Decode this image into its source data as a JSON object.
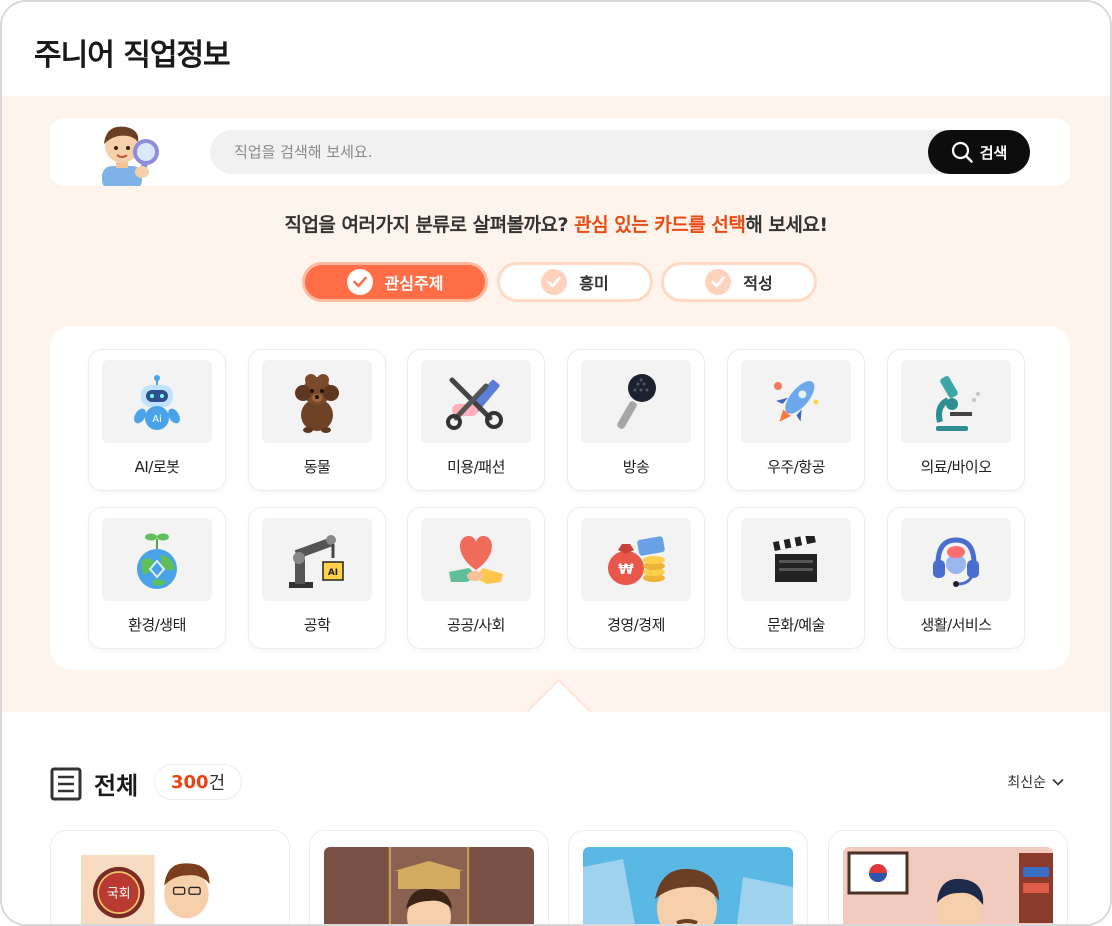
{
  "header": {
    "title": "주니어 직업정보"
  },
  "search": {
    "placeholder": "직업을 검색해 보세요.",
    "button_label": "검색"
  },
  "prompt": {
    "before": "직업을 여러가지 분류로 살펴볼까요? ",
    "highlight": "관심 있는 카드를 선택",
    "after": "해 보세요!"
  },
  "tabs": [
    {
      "label": "관심주제",
      "active": true
    },
    {
      "label": "흥미",
      "active": false
    },
    {
      "label": "적성",
      "active": false
    }
  ],
  "categories": [
    {
      "label": "AI/로봇",
      "icon": "robot-icon"
    },
    {
      "label": "동물",
      "icon": "dog-icon"
    },
    {
      "label": "미용/패션",
      "icon": "scissors-comb-icon"
    },
    {
      "label": "방송",
      "icon": "microphone-icon"
    },
    {
      "label": "우주/항공",
      "icon": "rocket-icon"
    },
    {
      "label": "의료/바이오",
      "icon": "microscope-icon"
    },
    {
      "label": "환경/생태",
      "icon": "earth-sprout-icon"
    },
    {
      "label": "공학",
      "icon": "robot-arm-icon"
    },
    {
      "label": "공공/사회",
      "icon": "heart-hands-icon"
    },
    {
      "label": "경영/경제",
      "icon": "money-bag-icon"
    },
    {
      "label": "문화/예술",
      "icon": "clapperboard-icon"
    },
    {
      "label": "생활/서비스",
      "icon": "headset-icon"
    }
  ],
  "list": {
    "title": "전체",
    "count_number": "300",
    "count_unit": "건",
    "sort_label": "최신순"
  },
  "job_cards": [
    {
      "image_icon": "assembly-seal-person",
      "seal_text": "국회"
    },
    {
      "image_icon": "hall-person"
    },
    {
      "image_icon": "building-person"
    },
    {
      "image_icon": "flag-office-person"
    }
  ],
  "colors": {
    "accent": "#ff6e47",
    "highlight": "#ea4b15",
    "peach_bg": "#fff4ec"
  }
}
